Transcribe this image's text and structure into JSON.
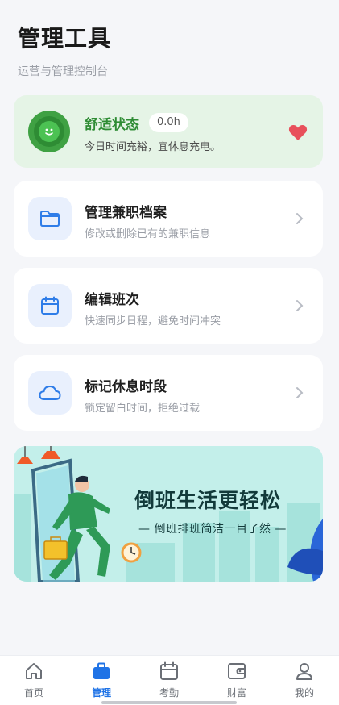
{
  "header": {
    "title": "管理工具",
    "subtitle": "运营与管理控制台"
  },
  "status_card": {
    "title": "舒适状态",
    "badge": "0.0h",
    "description": "今日时间充裕，宜休息充电。"
  },
  "menu": [
    {
      "title": "管理兼职档案",
      "description": "修改或删除已有的兼职信息",
      "icon": "folder-icon"
    },
    {
      "title": "编辑班次",
      "description": "快速同步日程，避免时间冲突",
      "icon": "calendar-icon"
    },
    {
      "title": "标记休息时段",
      "description": "锁定留白时间，拒绝过载",
      "icon": "cloud-icon"
    }
  ],
  "banner": {
    "title": "倒班生活更轻松",
    "subtitle": "— 倒班排班简洁一目了然 —"
  },
  "tabbar": {
    "items": [
      {
        "label": "首页",
        "icon": "home-icon"
      },
      {
        "label": "管理",
        "icon": "briefcase-icon",
        "active": true
      },
      {
        "label": "考勤",
        "icon": "calendar-icon"
      },
      {
        "label": "财富",
        "icon": "wallet-icon"
      },
      {
        "label": "我的",
        "icon": "user-icon"
      }
    ]
  },
  "colors": {
    "accent": "#1f73e6",
    "status_green": "#2e8c34",
    "heart": "#e8505b"
  }
}
